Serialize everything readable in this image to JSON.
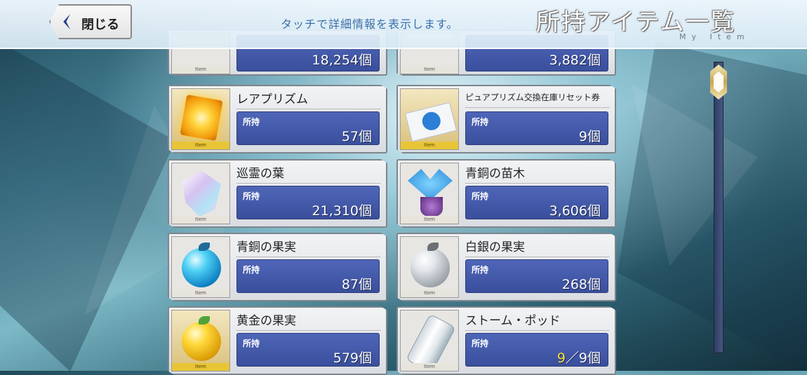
{
  "header": {
    "close_label": "閉じる",
    "hint": "タッチで詳細情報を表示します。",
    "title": "所持アイテム一覧",
    "subtitle": "My Item"
  },
  "items": [
    {
      "name": "",
      "owned_label": "",
      "count": "18,254個",
      "tag": "Item"
    },
    {
      "name": "",
      "owned_label": "",
      "count": "3,882個",
      "tag": "Item"
    },
    {
      "name": "レアプリズム",
      "owned_label": "所持",
      "count": "57個",
      "tag": "Item"
    },
    {
      "name": "ピュアプリズム交換在庫リセット券",
      "owned_label": "所持",
      "count": "9個",
      "tag": "Item"
    },
    {
      "name": "巡霊の葉",
      "owned_label": "所持",
      "count": "21,310個",
      "tag": "Item"
    },
    {
      "name": "青銅の苗木",
      "owned_label": "所持",
      "count": "3,606個",
      "tag": "Item"
    },
    {
      "name": "青銅の果実",
      "owned_label": "所持",
      "count": "87個",
      "tag": "Item"
    },
    {
      "name": "白銀の果実",
      "owned_label": "所持",
      "count": "268個",
      "tag": "Item"
    },
    {
      "name": "黄金の果実",
      "owned_label": "所持",
      "count": "579個",
      "tag": "Item"
    },
    {
      "name": "ストーム・ポッド",
      "owned_label": "所持",
      "count_current": "9",
      "count_rest": "／9個",
      "tag": "Item"
    }
  ],
  "colors": {
    "count_box": "#4a60b0",
    "highlight": "#f8e43a",
    "gold_frame": "#e8c536"
  },
  "icons": [
    "back-chevron-icon",
    "prism-icon",
    "ticket-icon",
    "leaf-icon",
    "sapling-icon",
    "blue-apple-icon",
    "silver-apple-icon",
    "gold-apple-icon",
    "storm-pod-icon"
  ]
}
